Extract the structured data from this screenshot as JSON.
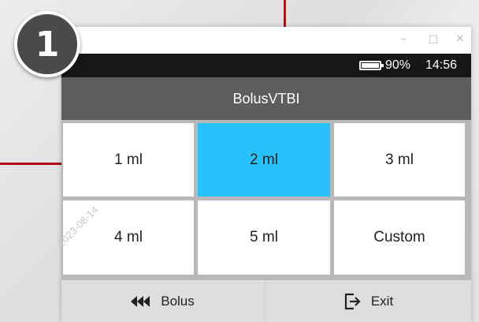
{
  "step_badge": "1",
  "window_controls": {
    "minimize": "–",
    "maximize": "□",
    "close": "✕"
  },
  "status": {
    "battery_icon": "battery-icon",
    "battery": "90%",
    "time": "14:56"
  },
  "screen_title": "BolusVTBI",
  "options": [
    {
      "label": "1 ml",
      "selected": false
    },
    {
      "label": "2 ml",
      "selected": true
    },
    {
      "label": "3 ml",
      "selected": false
    },
    {
      "label": "4 ml",
      "selected": false
    },
    {
      "label": "5 ml",
      "selected": false
    },
    {
      "label": "Custom",
      "selected": false
    }
  ],
  "footer": {
    "back_label": "Bolus",
    "back_icon": "rewind-icon",
    "exit_label": "Exit",
    "exit_icon": "exit-icon"
  },
  "watermark": "2023-08-14",
  "colors": {
    "selected": "#27c2fb",
    "header": "#5d5d5d",
    "status_bar": "#161616",
    "accent_line": "#b01018"
  }
}
